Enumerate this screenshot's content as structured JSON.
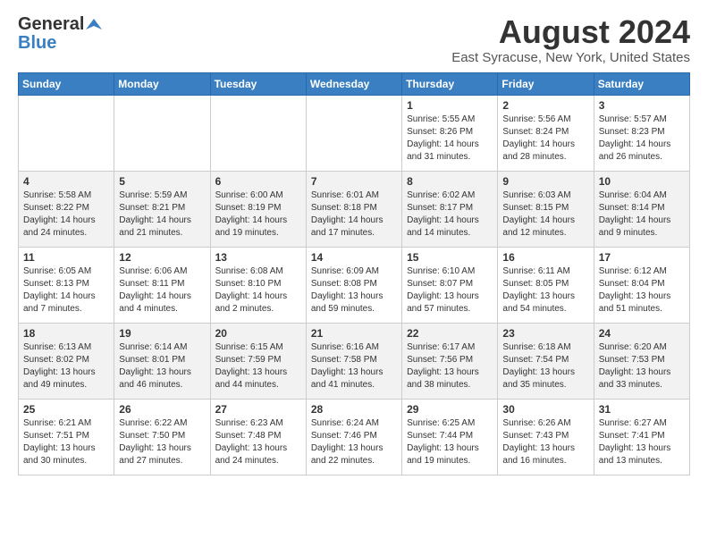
{
  "header": {
    "logo_general": "General",
    "logo_blue": "Blue",
    "month_year": "August 2024",
    "location": "East Syracuse, New York, United States"
  },
  "weekdays": [
    "Sunday",
    "Monday",
    "Tuesday",
    "Wednesday",
    "Thursday",
    "Friday",
    "Saturday"
  ],
  "weeks": [
    [
      {
        "day": "",
        "content": ""
      },
      {
        "day": "",
        "content": ""
      },
      {
        "day": "",
        "content": ""
      },
      {
        "day": "",
        "content": ""
      },
      {
        "day": "1",
        "content": "Sunrise: 5:55 AM\nSunset: 8:26 PM\nDaylight: 14 hours\nand 31 minutes."
      },
      {
        "day": "2",
        "content": "Sunrise: 5:56 AM\nSunset: 8:24 PM\nDaylight: 14 hours\nand 28 minutes."
      },
      {
        "day": "3",
        "content": "Sunrise: 5:57 AM\nSunset: 8:23 PM\nDaylight: 14 hours\nand 26 minutes."
      }
    ],
    [
      {
        "day": "4",
        "content": "Sunrise: 5:58 AM\nSunset: 8:22 PM\nDaylight: 14 hours\nand 24 minutes."
      },
      {
        "day": "5",
        "content": "Sunrise: 5:59 AM\nSunset: 8:21 PM\nDaylight: 14 hours\nand 21 minutes."
      },
      {
        "day": "6",
        "content": "Sunrise: 6:00 AM\nSunset: 8:19 PM\nDaylight: 14 hours\nand 19 minutes."
      },
      {
        "day": "7",
        "content": "Sunrise: 6:01 AM\nSunset: 8:18 PM\nDaylight: 14 hours\nand 17 minutes."
      },
      {
        "day": "8",
        "content": "Sunrise: 6:02 AM\nSunset: 8:17 PM\nDaylight: 14 hours\nand 14 minutes."
      },
      {
        "day": "9",
        "content": "Sunrise: 6:03 AM\nSunset: 8:15 PM\nDaylight: 14 hours\nand 12 minutes."
      },
      {
        "day": "10",
        "content": "Sunrise: 6:04 AM\nSunset: 8:14 PM\nDaylight: 14 hours\nand 9 minutes."
      }
    ],
    [
      {
        "day": "11",
        "content": "Sunrise: 6:05 AM\nSunset: 8:13 PM\nDaylight: 14 hours\nand 7 minutes."
      },
      {
        "day": "12",
        "content": "Sunrise: 6:06 AM\nSunset: 8:11 PM\nDaylight: 14 hours\nand 4 minutes."
      },
      {
        "day": "13",
        "content": "Sunrise: 6:08 AM\nSunset: 8:10 PM\nDaylight: 14 hours\nand 2 minutes."
      },
      {
        "day": "14",
        "content": "Sunrise: 6:09 AM\nSunset: 8:08 PM\nDaylight: 13 hours\nand 59 minutes."
      },
      {
        "day": "15",
        "content": "Sunrise: 6:10 AM\nSunset: 8:07 PM\nDaylight: 13 hours\nand 57 minutes."
      },
      {
        "day": "16",
        "content": "Sunrise: 6:11 AM\nSunset: 8:05 PM\nDaylight: 13 hours\nand 54 minutes."
      },
      {
        "day": "17",
        "content": "Sunrise: 6:12 AM\nSunset: 8:04 PM\nDaylight: 13 hours\nand 51 minutes."
      }
    ],
    [
      {
        "day": "18",
        "content": "Sunrise: 6:13 AM\nSunset: 8:02 PM\nDaylight: 13 hours\nand 49 minutes."
      },
      {
        "day": "19",
        "content": "Sunrise: 6:14 AM\nSunset: 8:01 PM\nDaylight: 13 hours\nand 46 minutes."
      },
      {
        "day": "20",
        "content": "Sunrise: 6:15 AM\nSunset: 7:59 PM\nDaylight: 13 hours\nand 44 minutes."
      },
      {
        "day": "21",
        "content": "Sunrise: 6:16 AM\nSunset: 7:58 PM\nDaylight: 13 hours\nand 41 minutes."
      },
      {
        "day": "22",
        "content": "Sunrise: 6:17 AM\nSunset: 7:56 PM\nDaylight: 13 hours\nand 38 minutes."
      },
      {
        "day": "23",
        "content": "Sunrise: 6:18 AM\nSunset: 7:54 PM\nDaylight: 13 hours\nand 35 minutes."
      },
      {
        "day": "24",
        "content": "Sunrise: 6:20 AM\nSunset: 7:53 PM\nDaylight: 13 hours\nand 33 minutes."
      }
    ],
    [
      {
        "day": "25",
        "content": "Sunrise: 6:21 AM\nSunset: 7:51 PM\nDaylight: 13 hours\nand 30 minutes."
      },
      {
        "day": "26",
        "content": "Sunrise: 6:22 AM\nSunset: 7:50 PM\nDaylight: 13 hours\nand 27 minutes."
      },
      {
        "day": "27",
        "content": "Sunrise: 6:23 AM\nSunset: 7:48 PM\nDaylight: 13 hours\nand 24 minutes."
      },
      {
        "day": "28",
        "content": "Sunrise: 6:24 AM\nSunset: 7:46 PM\nDaylight: 13 hours\nand 22 minutes."
      },
      {
        "day": "29",
        "content": "Sunrise: 6:25 AM\nSunset: 7:44 PM\nDaylight: 13 hours\nand 19 minutes."
      },
      {
        "day": "30",
        "content": "Sunrise: 6:26 AM\nSunset: 7:43 PM\nDaylight: 13 hours\nand 16 minutes."
      },
      {
        "day": "31",
        "content": "Sunrise: 6:27 AM\nSunset: 7:41 PM\nDaylight: 13 hours\nand 13 minutes."
      }
    ]
  ]
}
